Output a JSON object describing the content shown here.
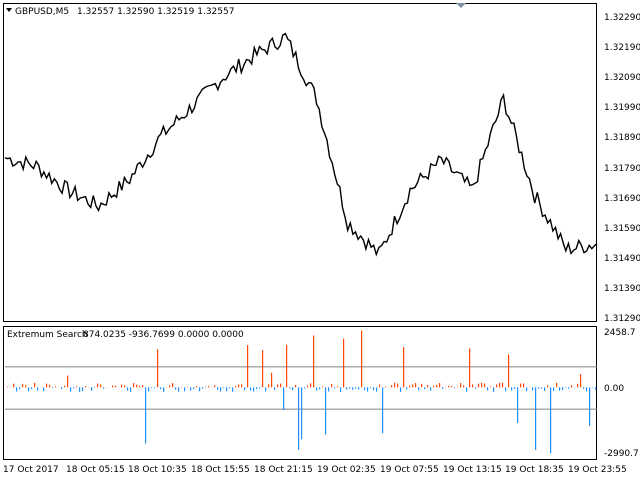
{
  "chart_header": {
    "symbol_timeframe": "GBPUSD,M5",
    "ohlc": "1.32557 1.32590 1.32519 1.32557"
  },
  "indicator_header": {
    "name": "Extremum Search",
    "values": "874.0235 -936.7699 0.0000 0.0000"
  },
  "price_axis": {
    "labels": [
      "1.32290",
      "1.32190",
      "1.32090",
      "1.31990",
      "1.31890",
      "1.31790",
      "1.31690",
      "1.31590",
      "1.31490",
      "1.31390",
      "1.31290"
    ],
    "current_price": "1.32557"
  },
  "indicator_axis": {
    "top_label": "2458.7",
    "zero_label": "0.00",
    "bottom_label": "-2990.7"
  },
  "time_axis": {
    "labels": [
      "17 Oct 2017",
      "18 Oct 05:15",
      "18 Oct 10:35",
      "18 Oct 15:55",
      "18 Oct 21:15",
      "19 Oct 02:35",
      "19 Oct 07:55",
      "19 Oct 13:15",
      "19 Oct 18:35",
      "19 Oct 23:55"
    ]
  },
  "colors": {
    "price_line": "#000000",
    "positive_bars": "#ff4500",
    "negative_bars": "#1e90ff",
    "band_lines": "#808080",
    "frame": "#000000"
  },
  "icons": {
    "header_arrow": "triangle-down-icon",
    "shift_marker": "triangle-down-marker-icon"
  },
  "chart_data": [
    {
      "type": "line",
      "title": "GBPUSD,M5",
      "x": [
        "17 Oct 2017",
        "18 Oct 05:15",
        "18 Oct 10:35",
        "18 Oct 15:55",
        "18 Oct 21:15",
        "19 Oct 02:35",
        "19 Oct 07:55",
        "19 Oct 13:15",
        "19 Oct 18:35",
        "19 Oct 23:55"
      ],
      "series": [
        {
          "values_approx": [
            1.3184,
            1.3181,
            1.3172,
            1.3166,
            1.3176,
            1.3192,
            1.3203,
            1.3214,
            1.3222,
            1.3229,
            1.3206,
            1.316,
            1.3148,
            1.3172,
            1.3183,
            1.3172,
            1.3206,
            1.317,
            1.315,
            1.3152
          ]
        }
      ],
      "ylim": [
        1.3124,
        1.3236
      ],
      "grid": false
    },
    {
      "type": "bar",
      "title": "Extremum Search",
      "values_range": [
        -2990.7,
        2458.7
      ],
      "upper_band_approx": 874.0,
      "lower_band_approx": -936.8
    }
  ]
}
